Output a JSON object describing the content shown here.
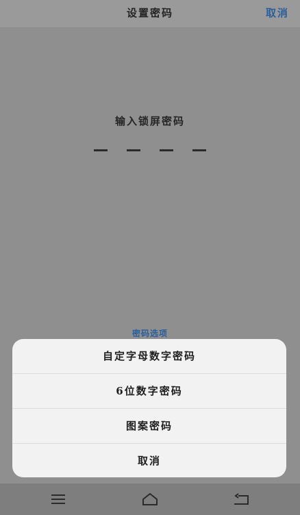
{
  "header": {
    "title": "设置密码",
    "cancel": "取消"
  },
  "main": {
    "prompt": "输入锁屏密码",
    "pin_length": 4,
    "options_label": "密码选项"
  },
  "sheet": {
    "items": [
      "自定字母数字密码",
      "6位数字密码",
      "图案密码",
      "取消"
    ]
  },
  "nav": {
    "icons": [
      "menu-icon",
      "home-icon",
      "back-icon"
    ]
  }
}
